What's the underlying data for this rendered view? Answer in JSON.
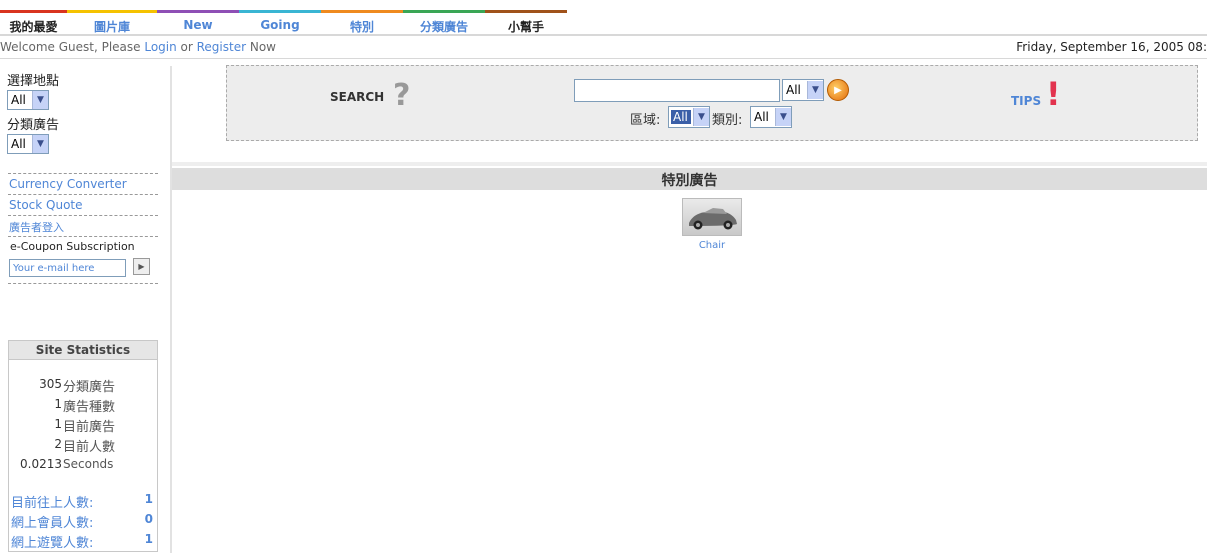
{
  "nav": {
    "tabs": [
      {
        "label": "我的最愛",
        "color": "#d9341f",
        "dark": true
      },
      {
        "label": "圖片庫",
        "color": "#f5c200",
        "dark": false
      },
      {
        "label": "New",
        "color": "#8e4fb5",
        "dark": false
      },
      {
        "label": "Going",
        "color": "#39b5d3",
        "dark": false
      },
      {
        "label": "特別",
        "color": "#ef8a1f",
        "dark": false
      },
      {
        "label": "分類廣告",
        "color": "#3aa655",
        "dark": false
      },
      {
        "label": "小幫手",
        "color": "#a0521a",
        "dark": true
      }
    ]
  },
  "welcome": {
    "prefix": "Welcome Guest, Please ",
    "login": "Login",
    "or": " or ",
    "register": "Register",
    "suffix": " Now",
    "date": "Friday, September 16, 2005 08:"
  },
  "sidebar": {
    "location_label": "選擇地點",
    "location_value": "All",
    "category_label": "分類廣告",
    "category_value": "All",
    "links": [
      "Currency Converter",
      "Stock Quote",
      "廣告者登入"
    ],
    "ecoupon_label": "e-Coupon Subscription",
    "email_placeholder": "Your e-mail here"
  },
  "stats": {
    "title": "Site Statistics",
    "rows": [
      {
        "num": "305",
        "label": "分類廣告"
      },
      {
        "num": "1",
        "label": "廣告種數"
      },
      {
        "num": "1",
        "label": "目前廣告"
      },
      {
        "num": "2",
        "label": "目前人數"
      },
      {
        "num": "0.0213",
        "label": "Seconds"
      }
    ],
    "online": [
      {
        "label": "目前往上人數:",
        "count": "1"
      },
      {
        "label": "網上會員人數:",
        "count": "0"
      },
      {
        "label": "網上遊覽人數:",
        "count": "1"
      }
    ]
  },
  "search": {
    "label": "SEARCH",
    "scope_value": "All",
    "region_label": "區域:",
    "region_value": "All",
    "type_label": "類別:",
    "type_value": "All",
    "tips_label": "TIPS"
  },
  "specials": {
    "header": "特別廣告",
    "item_caption": "Chair"
  }
}
